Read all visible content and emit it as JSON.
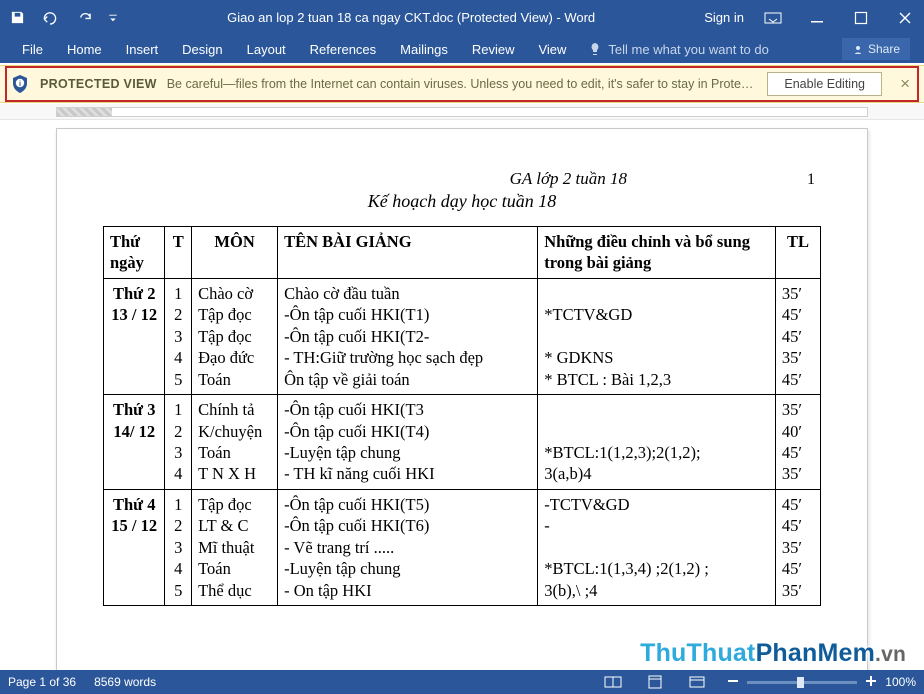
{
  "titlebar": {
    "doc_title": "Giao an lop 2 tuan 18 ca ngay CKT.doc (Protected View)  -  Word",
    "sign_in": "Sign in"
  },
  "ribbon": {
    "tabs": [
      "File",
      "Home",
      "Insert",
      "Design",
      "Layout",
      "References",
      "Mailings",
      "Review",
      "View"
    ],
    "tellme": "Tell me what you want to do",
    "share": "Share"
  },
  "pv": {
    "title": "PROTECTED VIEW",
    "msg": "Be careful—files from the Internet can contain viruses. Unless you need to edit, it's safer to stay in Protected View.",
    "button": "Enable Editing"
  },
  "doc": {
    "header_title": "GA lớp 2 tuần 18",
    "header_page": "1",
    "plan_title": "Kế hoạch dạy học tuần 18",
    "header": {
      "thungay": "Thứ ngày",
      "t": "T",
      "mon": "MÔN",
      "ten": "TÊN    BÀI  GIẢNG",
      "bosung": "Những điều chỉnh và bổ sung trong bài giảng",
      "tl": "TL"
    },
    "rows": [
      {
        "thungay": "Thứ 2\n13 / 12",
        "t": "1\n2\n3\n4\n5",
        "mon": "Chào cờ\nTập đọc\nTập đọc\nĐạo đức\nToán",
        "ten": "Chào cờ đầu tuần\n-Ôn tập cuối HKI(T1)\n-Ôn tập cuối HKI(T2-\n- TH:Giữ trường học sạch đẹp\nÔn tập về giải toán",
        "bosung": "\n*TCTV&GD\n\n  * GDKNS\n* BTCL : Bài 1,2,3",
        "tl": "35ʹ\n45ʹ\n45ʹ\n35ʹ\n45ʹ"
      },
      {
        "thungay": "Thứ 3\n14/ 12",
        "t": "1\n2\n3\n4\n ",
        "mon": "Chính tả\nK/chuyện\n Toán\nT N X H",
        "ten": "-Ôn tập cuối HKI(T3\n-Ôn tập cuối HKI(T4)\n-Luyện tập chung\n- TH kĩ năng cuối HKI",
        "bosung": "\n\n*BTCL:1(1,2,3);2(1,2);\n3(a,b)4",
        "tl": "35ʹ\n40ʹ\n45ʹ\n35ʹ"
      },
      {
        "thungay": "Thứ 4\n15 / 12",
        "t": "1\n2\n3\n4\n5",
        "mon": "Tập đọc\nLT & C\nMĩ thuật\nToán\nThể dục",
        "ten": "-Ôn tập cuối HKI(T5)\n-Ôn tập cuối HKI(T6)\n- Vẽ trang trí .....\n-Luyện tập chung\n- On tập HKI",
        "bosung": "-TCTV&GD\n-\n\n*BTCL:1(1,3,4) ;2(1,2) ;\n3(b),\\ ;4",
        "tl": "45ʹ\n45ʹ\n35ʹ\n45ʹ\n35ʹ"
      }
    ]
  },
  "status": {
    "page": "Page 1 of 36",
    "words": "8569 words",
    "zoom": "100%"
  },
  "watermark": {
    "a": "ThuThuat",
    "b": "PhanMem",
    "c": ".vn"
  }
}
